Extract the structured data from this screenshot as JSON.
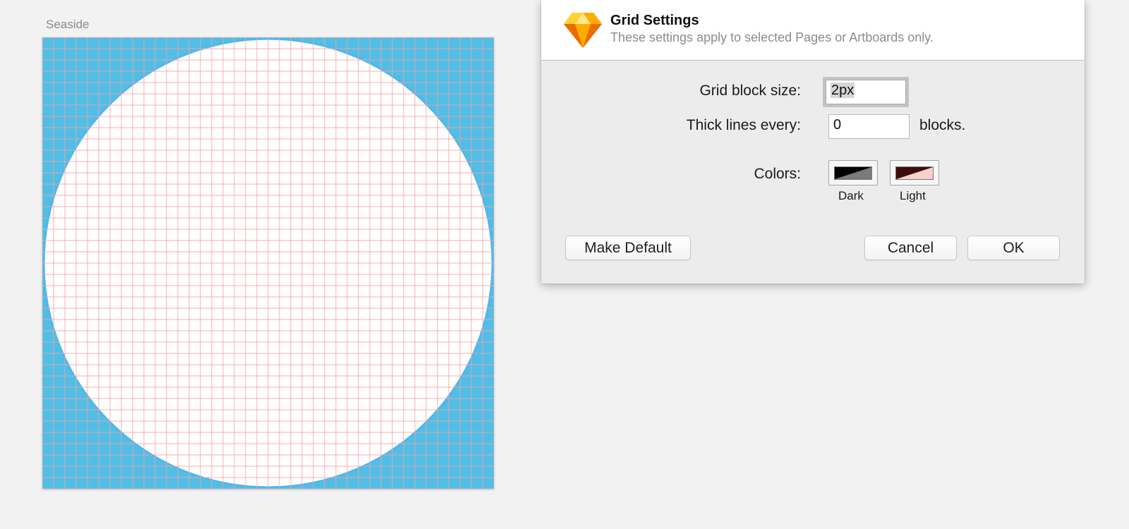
{
  "canvas": {
    "artboard_name": "Seaside",
    "background_color": "#52bee6",
    "grid_color": "#f4a3a3",
    "circle_fill": "#ffffff",
    "circle_stroke": "#4db8ec"
  },
  "dialog": {
    "title": "Grid Settings",
    "subtitle": "These settings apply to selected Pages or Artboards only.",
    "app_icon": "sketch-diamond-icon",
    "grid_block_size": {
      "label": "Grid block size:",
      "value": "2px"
    },
    "thick_lines": {
      "label": "Thick lines every:",
      "value": "0",
      "suffix": "blocks."
    },
    "colors": {
      "label": "Colors:",
      "dark": {
        "caption": "Dark",
        "primary": "#000000",
        "secondary": "#7a7a7a"
      },
      "light": {
        "caption": "Light",
        "primary": "#3b0d0d",
        "secondary": "#f7cfcf"
      }
    },
    "buttons": {
      "make_default": "Make Default",
      "cancel": "Cancel",
      "ok": "OK"
    }
  }
}
